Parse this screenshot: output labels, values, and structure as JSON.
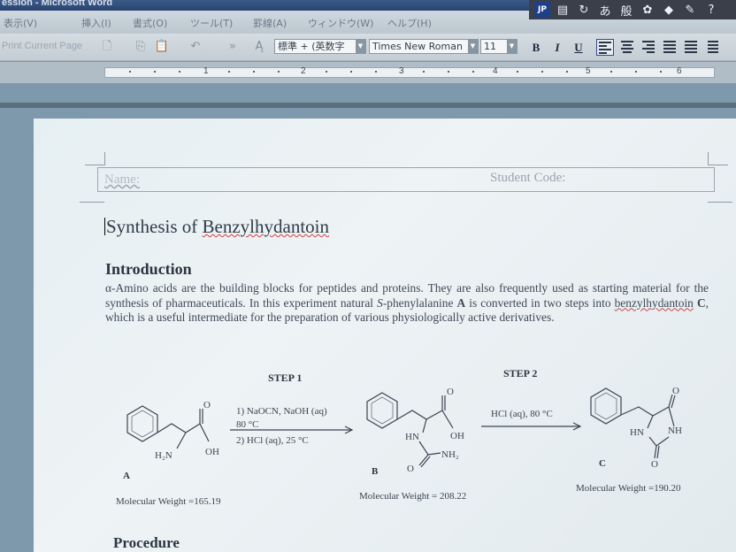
{
  "window": {
    "title": "ession - Microsoft Word"
  },
  "menu": [
    "表示(V)",
    "挿入(I)",
    "書式(O)",
    "ツール(T)",
    "罫線(A)",
    "ウィンドウ(W)",
    "ヘルプ(H)"
  ],
  "language_bar": {
    "badge": "JP",
    "mode_glyph": "あ",
    "kanji_glyph": "般"
  },
  "toolbar": {
    "print_label": "Print Current Page",
    "style": "標準 + (英数字",
    "font": "Times New Roman",
    "size": "11",
    "bold": "B",
    "italic": "I",
    "underline": "U"
  },
  "ruler": {
    "numbers": [
      "1",
      "2",
      "3",
      "4",
      "5",
      "6"
    ]
  },
  "document": {
    "name_label": "Name:",
    "student_code_label": "Student Code:",
    "title_pre": "Synthesis of ",
    "title_word": "Benzylhydantoin",
    "intro_heading": "Introduction",
    "para_part1": "α-Amino acids are the building blocks for peptides and proteins. They are also frequently used as starting material for the synthesis of pharmaceuticals. In this experiment natural ",
    "para_italic": "S",
    "para_part2": "-phenylalanine ",
    "para_A": "A",
    "para_part3": " is converted in two steps into ",
    "para_word": "benzylhydantoin",
    "para_sp": " ",
    "para_C": "C",
    "para_part4": ", which is a useful intermediate for the preparation of various physiologically active derivatives.",
    "procedure_heading": "Procedure"
  },
  "scheme": {
    "step1": "STEP 1",
    "step2": "STEP 2",
    "step1_cond1": "1) NaOCN, NaOH (aq)",
    "step1_cond2": "80 °C",
    "step1_cond3": "2) HCl (aq), 25 °C",
    "step2_cond": "HCl (aq), 80 °C",
    "compound_A": "A",
    "compound_B": "B",
    "compound_C": "C",
    "mw_A": "Molecular Weight =165.19",
    "mw_B": "Molecular Weight = 208.22",
    "mw_C": "Molecular Weight =190.20",
    "atoms": {
      "A_O": "O",
      "A_H2N": "H₂N",
      "A_OH": "OH",
      "B_O": "O",
      "B_HN": "HN",
      "B_OH": "OH",
      "B_O2": "O",
      "B_NH2": "NH₂",
      "C_O": "O",
      "C_HN": "HN",
      "C_NH": "NH",
      "C_O2": "O"
    }
  }
}
